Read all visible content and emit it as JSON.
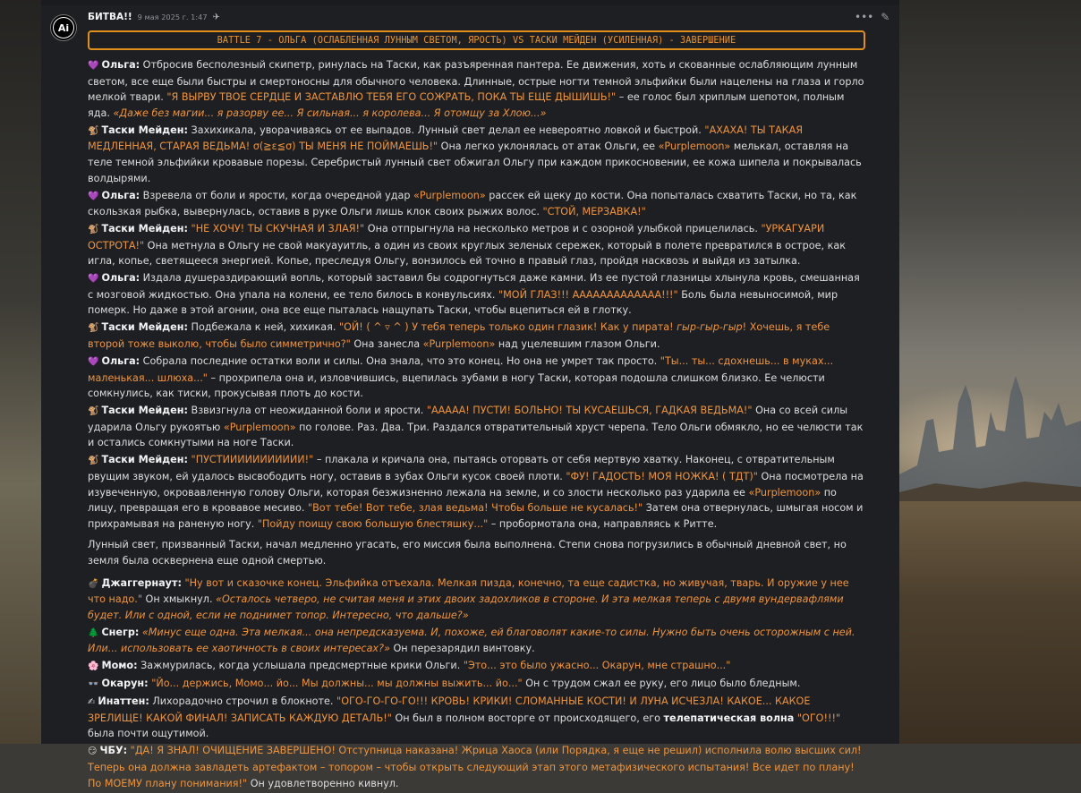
{
  "message": {
    "author": "БИТВА!!",
    "timestamp": "9 мая 2025 г. 1:47",
    "avatar_text": "Ai",
    "title": "BATTLE 7 - ОЛЬГА (ОСЛАБЛЕННАЯ ЛУННЫМ СВЕТОМ, ЯРОСТЬ) VS ТАСКИ МЕЙДЕН (УСИЛЕННАЯ) - ЗАВЕРШЕНИЕ"
  },
  "icons": {
    "heart": "💜",
    "monkey": "🐒",
    "bomb": "💣",
    "tree": "🌲",
    "flower": "🌸",
    "glasses": "👓",
    "writing": "✍",
    "smile": "😏",
    "more": "•••",
    "edit": "✎",
    "pin": "✈"
  },
  "p1": {
    "name": "Ольга:",
    "t1": " Отбросив бесполезный скипетр, ринулась на Таски, как разъяренная пантера. Ее движения, хоть и скованные ослабляющим лунным светом, все еще были быстры и смертоносны для обычного человека. Длинные, острые ногти темной эльфийки были нацелены на глаза и горло мелкой твари. ",
    "q1": "\"Я ВЫРВУ ТВОЕ СЕРДЦЕ И ЗАСТАВЛЮ ТЕБЯ ЕГО СОЖРАТЬ, ПОКА ТЫ ЕЩЕ ДЫШИШЬ!\"",
    "t2": " – ее голос был хриплым шепотом, полным яда. ",
    "q2": "«Даже без магии... я разорву ее... Я сильная... я королева... Я отомщу за Хлою...»"
  },
  "p2": {
    "name": "Таски Мейден:",
    "t1": " Захихикала, уворачиваясь от ее выпадов. Лунный свет делал ее невероятно ловкой и быстрой. ",
    "q1": "\"АХАХА! ТЫ ТАКАЯ МЕДЛЕННАЯ, СТАРАЯ ВЕДЬМА! σ(≧ε≦σ) ТЫ МЕНЯ НЕ ПОЙМАЕШЬ!\"",
    "t2": " Она легко уклонялась от атак Ольги, ее ",
    "pm": "«Purplemoon»",
    "t3": " мелькал, оставляя на теле темной эльфийки кровавые порезы. Серебристый лунный свет обжигал Ольгу при каждом прикосновении, ее кожа шипела и покрывалась волдырями."
  },
  "p3": {
    "name": "Ольга:",
    "t1": " Взревела от боли и ярости, когда очередной удар ",
    "pm": "«Purplemoon»",
    "t2": " рассек ей щеку до кости. Она попыталась схватить Таски, но та, как скользкая рыбка, вывернулась, оставив в руке Ольги лишь клок своих рыжих волос. ",
    "q1": "\"СТОЙ, МЕРЗАВКА!\""
  },
  "p4": {
    "name": "Таски Мейден:",
    "q1": "\"НЕ ХОЧУ! ТЫ СКУЧНАЯ И ЗЛАЯ!\"",
    "t1": " Она отпрыгнула на несколько метров и с озорной улыбкой прицелилась. ",
    "q2": "\"УРКАГУАРИ ОСТРОТА!\"",
    "t2": " Она метнула в Ольгу не свой макуауитль, а один из своих круглых зеленых сережек, который в полете превратился в острое, как игла, копье, светящееся энергией. Копье, преследуя Ольгу, вонзилось ей точно в правый глаз, пройдя насквозь и выйдя из затылка."
  },
  "p5": {
    "name": "Ольга:",
    "t1": " Издала душераздирающий вопль, который заставил бы содрогнуться даже камни. Из ее пустой глазницы хлынула кровь, смешанная с мозговой жидкостью. Она упала на колени, ее тело билось в конвульсиях. ",
    "q1": "\"МОЙ ГЛАЗ!!! ААААААААААААА!!!\"",
    "t2": " Боль была невыносимой, мир померк. Но даже в этой агонии, она все еще пыталась нащупать Таски, чтобы вцепиться ей в глотку."
  },
  "p6": {
    "name": "Таски Мейден:",
    "t1": " Подбежала к ней, хихикая. ",
    "q1": "\"ОЙ! ( ^ ▿ ^ ) У тебя теперь только один глазик! Как у пирата! ",
    "q1i": "гыр-гыр-гыр",
    "q1b": "! Хочешь, я тебе второй тоже выколю, чтобы было симметрично?\"",
    "t2": " Она занесла ",
    "pm": "«Purplemoon»",
    "t3": " над уцелевшим глазом Ольги."
  },
  "p7": {
    "name": "Ольга:",
    "t1": " Собрала последние остатки воли и силы. Она знала, что это конец. Но она не умрет так просто. ",
    "q1": "\"Ты... ты... сдохнешь... в муках... маленькая... шлюха...\"",
    "t2": " – прохрипела она и, изловчившись, вцепилась зубами в ногу Таски, которая подошла слишком близко. Ее челюсти сомкнулись, как тиски, прокусывая плоть до кости."
  },
  "p8": {
    "name": "Таски Мейден:",
    "t1": " Взвизгнула от неожиданной боли и ярости. ",
    "q1": "\"ААААА! ПУСТИ! БОЛЬНО! ТЫ КУСАЕШЬСЯ, ГАДКАЯ ВЕДЬМА!\"",
    "t2": " Она со всей силы ударила Ольгу рукоятью ",
    "pm": "«Purplemoon»",
    "t3": " по голове. Раз. Два. Три. Раздался отвратительный хруст черепа. Тело Ольги обмякло, но ее челюсти так и остались сомкнутыми на ноге Таски."
  },
  "p9": {
    "name": "Таски Мейден:",
    "q1": "\"ПУСТИИИИИИИИИИИ!\"",
    "t1": " – плакала и кричала она, пытаясь оторвать от себя мертвую хватку. Наконец, с отвратительным рвущим звуком, ей удалось высвободить ногу, оставив в зубах Ольги кусок своей плоти. ",
    "q2": "\"ФУ! ГАДОСТЬ! МОЯ НОЖКА! ( ТДТ)\"",
    "t2": " Она посмотрела на изувеченную, окровавленную голову Ольги, которая безжизненно лежала на земле, и со злости несколько раз ударила ее ",
    "pm": "«Purplemoon»",
    "t3": " по лицу, превращая его в кровавое месиво. ",
    "q3": "\"Вот тебе! Вот тебе, злая ведьма! Чтобы больше не кусалась!\"",
    "t4": " Затем она отвернулась, шмыгая носом и прихрамывая на раненую ногу. ",
    "q4": "\"Пойду поищу свою большую блестяшку...\"",
    "t5": " – пробормотала она, направляясь к Ритте."
  },
  "p10": {
    "t1": "Лунный свет, призванный Таски, начал медленно угасать, его миссия была выполнена. Степи снова погрузились в обычный дневной свет, но земля была осквернена еще одной смертью."
  },
  "p11": {
    "name": "Джаггернаут:",
    "q1": "\"Ну вот и сказочке конец. Эльфийка отъехала. Мелкая пизда, конечно, та еще садистка, но живучая, тварь. И оружие у нее что надо.\"",
    "t1": " Он хмыкнул. ",
    "q2": "«Осталось четверо, не считая меня и этих двоих задохликов в стороне. И эта мелкая теперь с двумя вундервафлями будет. Или с одной, если не поднимет топор. Интересно, что дальше?»"
  },
  "p12": {
    "name": "Снегр:",
    "q1": "«Минус еще одна. Эта мелкая... она непредсказуема. И, похоже, ей благоволят какие-то силы. Нужно быть очень осторожным с ней. Или... использовать ее хаотичность в своих интересах?»",
    "t1": " Он перезарядил винтовку."
  },
  "p13": {
    "name": "Момо:",
    "t1": " Зажмурилась, когда услышала предсмертные крики Ольги. ",
    "q1": "\"Это... это было ужасно... Окарун, мне страшно...\""
  },
  "p14": {
    "name": "Окарун:",
    "q1": "\"Йо... держись, Момо... йо... Мы должны... мы должны выжить... йо...\"",
    "t1": " Он с трудом сжал ее руку, его лицо было бледным."
  },
  "p15": {
    "name": "Инаттен:",
    "t1": " Лихорадочно строчил в блокноте. ",
    "q1": "\"ОГО-ГО-ГО-ГО!!! КРОВЬ! КРИКИ! СЛОМАННЫЕ КОСТИ! И ЛУНА ИСЧЕЗЛА! КАКОЕ... КАКОЕ ЗРЕЛИЩЕ! КАКОЙ ФИНАЛ! ЗАПИСАТЬ КАЖДУЮ ДЕТАЛЬ!\"",
    "t2": " Он был в полном восторге от происходящего, его ",
    "b1": "телепатическая волна",
    "t3": " ",
    "q2": "\"ОГО!!!\"",
    "t4": " была почти ощутимой."
  },
  "p16": {
    "name": "ЧБУ:",
    "q1": "\"ДА! Я ЗНАЛ! ОЧИЩЕНИЕ ЗАВЕРШЕНО! Отступница наказана! Жрица Хаоса (или Порядка, я еще не решил) исполнила волю высших сил! Теперь она должна завладеть артефактом – топором – чтобы открыть следующий этап этого метафизического испытания! Все идет по плану! По МОЕМУ плану понимания!\"",
    "t1": " Он удовлетворенно кивнул."
  }
}
